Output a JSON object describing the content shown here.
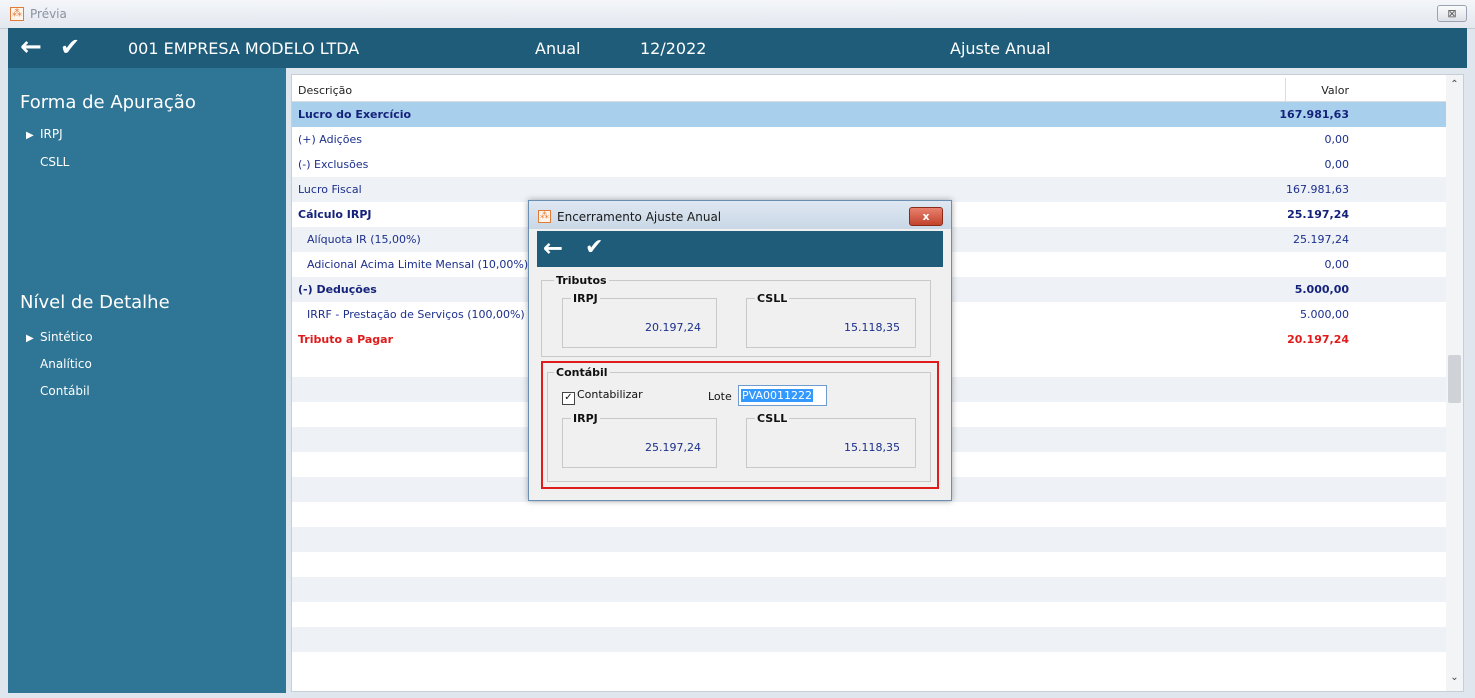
{
  "window": {
    "title": "Prévia",
    "close_glyph": "⊠",
    "icon_glyph": "⁂"
  },
  "header": {
    "company": "001 EMPRESA MODELO LTDA",
    "period_type": "Anual",
    "date": "12/2022",
    "mode": "Ajuste Anual"
  },
  "sidebar": {
    "forma_title": "Forma de Apuração",
    "forma_items": [
      {
        "label": "IRPJ",
        "selected": true
      },
      {
        "label": "CSLL",
        "selected": false
      }
    ],
    "nivel_title": "Nível de Detalhe",
    "nivel_items": [
      {
        "label": "Sintético",
        "selected": true
      },
      {
        "label": "Analítico",
        "selected": false
      },
      {
        "label": "Contábil",
        "selected": false
      }
    ]
  },
  "grid": {
    "headers": {
      "description": "Descrição",
      "value": "Valor"
    },
    "rows": [
      {
        "description": "Lucro do Exercício",
        "value": "167.981,63",
        "style": "bold",
        "indent": false
      },
      {
        "description": "(+) Adições",
        "value": "0,00",
        "style": "normal",
        "indent": false
      },
      {
        "description": "(-) Exclusões",
        "value": "0,00",
        "style": "normal",
        "indent": false
      },
      {
        "description": "Lucro Fiscal",
        "value": "167.981,63",
        "style": "normal",
        "indent": false
      },
      {
        "description": "Cálculo IRPJ",
        "value": "25.197,24",
        "style": "bold",
        "indent": false
      },
      {
        "description": "Alíquota IR (15,00%)",
        "value": "25.197,24",
        "style": "normal",
        "indent": true
      },
      {
        "description": "Adicional Acima Limite Mensal (10,00%)",
        "value": "0,00",
        "style": "normal",
        "indent": true
      },
      {
        "description": "(-) Deduções",
        "value": "5.000,00",
        "style": "bold",
        "indent": false
      },
      {
        "description": "IRRF - Prestação de Serviços (100,00%)",
        "value": "5.000,00",
        "style": "normal",
        "indent": true
      },
      {
        "description": "Tributo a Pagar",
        "value": "20.197,24",
        "style": "red",
        "indent": false
      }
    ]
  },
  "dialog": {
    "title": "Encerramento Ajuste Anual",
    "close_label": "x",
    "tributos": {
      "title": "Tributos",
      "irpj_label": "IRPJ",
      "irpj_value": "20.197,24",
      "csll_label": "CSLL",
      "csll_value": "15.118,35"
    },
    "contabil": {
      "title": "Contábil",
      "checkbox_label": "Contabilizar",
      "checked": true,
      "lote_label": "Lote",
      "lote_value": "PVA0011222",
      "irpj_label": "IRPJ",
      "irpj_value": "25.197,24",
      "csll_label": "CSLL",
      "csll_value": "15.118,35"
    }
  },
  "colors": {
    "header_bg": "#1e5c7a",
    "sidebar_bg": "#2e7596",
    "selected_row": "#a8d0ec",
    "text_blue": "#1c2f8c",
    "text_red": "#e01b1b",
    "highlight_frame": "#e01b1b"
  },
  "icons": {
    "back": "arrow-left-icon",
    "confirm": "checkmark-icon",
    "expand": "triangle-right-icon",
    "scroll_up": "chevron-up-icon",
    "scroll_down": "chevron-down-icon"
  }
}
